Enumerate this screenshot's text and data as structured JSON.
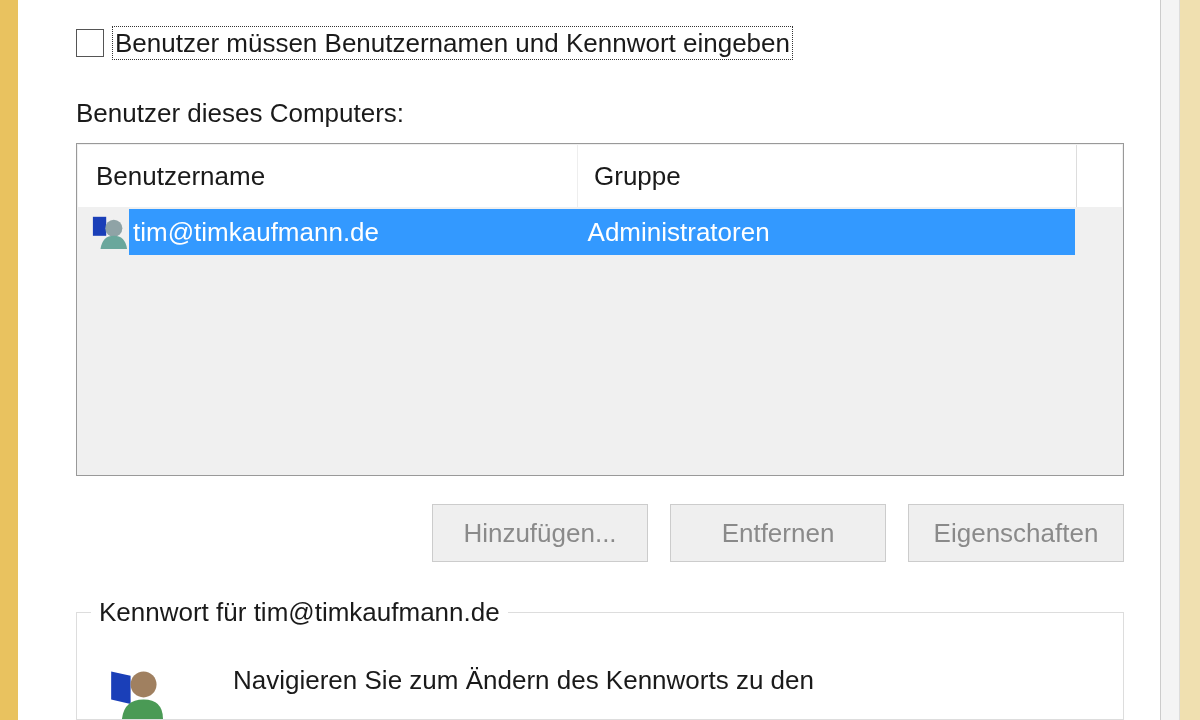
{
  "require_login": {
    "label": "Benutzer müssen Benutzernamen und Kennwort eingeben",
    "checked": false
  },
  "users_label": "Benutzer dieses Computers:",
  "table": {
    "columns": [
      "Benutzername",
      "Gruppe"
    ],
    "rows": [
      {
        "name": "tim@timkaufmann.de",
        "group": "Administratoren",
        "selected": true
      }
    ]
  },
  "buttons": [
    {
      "label": "Hinzufügen...",
      "disabled": true
    },
    {
      "label": "Entfernen",
      "disabled": true
    },
    {
      "label": "Eigenschaften",
      "disabled": true
    }
  ],
  "password_group": {
    "title": "Kennwort für tim@timkaufmann.de",
    "text": "Navigieren Sie zum Ändern des Kennworts zu den"
  }
}
